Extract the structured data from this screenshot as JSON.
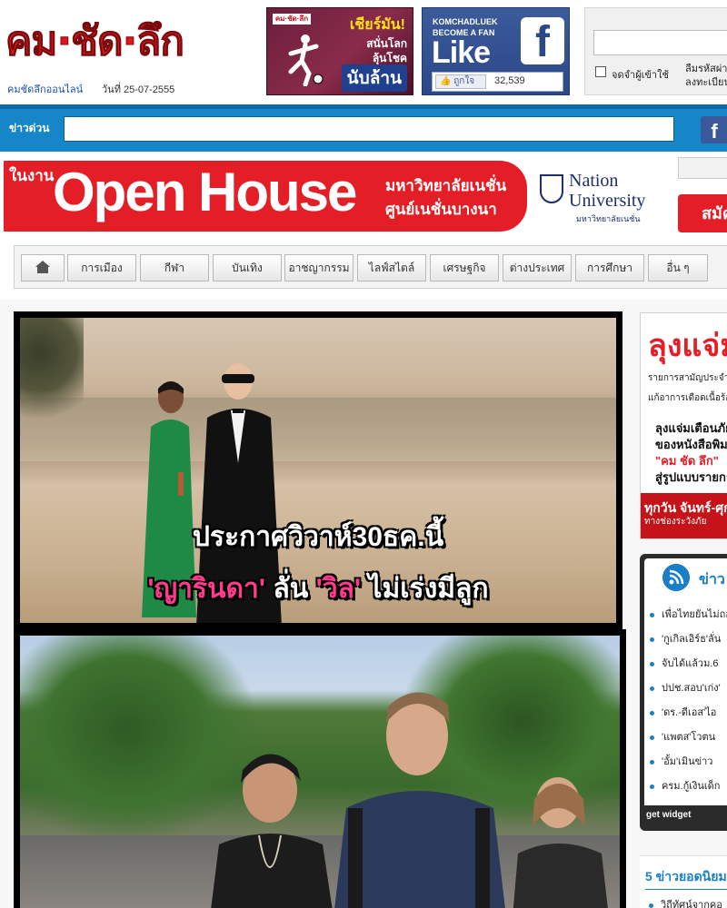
{
  "header": {
    "logo_text": "คม·ชัด·ลึก",
    "site_name": "คมชัดลึกออนไลน์",
    "date_text": "วันที่ 25-07-2555",
    "promo": {
      "logo": "คม·ชัด·ลึก",
      "line1": "เชียร์มัน!",
      "line2": "สนั่นโลก",
      "line3": "ลุ้นโชค",
      "line4": "นับล้าน"
    },
    "facebook": {
      "line1": "KOMCHADLUEK",
      "line2": "BECOME A FAN",
      "like_big": "Like",
      "f_glyph": "f",
      "like_button": "ถูกใจ",
      "like_count": "32,539"
    },
    "login": {
      "remember": "จดจำผู้เข้าใช้",
      "forgot": "ลืมรหัสผ่าน ลงทะเบียน"
    }
  },
  "news_bar": {
    "label": "ข่าวด่วน",
    "fb_glyph": "f"
  },
  "banner": {
    "small": "ในงาน",
    "big": "Open House",
    "uni_line1": "มหาวิทยาลัยเนชั่น",
    "uni_line2": "ศูนย์เนชั่นบางนา",
    "nation_line1": "Nation",
    "nation_line2": "University",
    "nation_th": "มหาวิทยาลัยเนชั่น",
    "side_button": "สมัคร"
  },
  "nav": {
    "items": [
      {
        "label": "การเมือง"
      },
      {
        "label": "กีฬา"
      },
      {
        "label": "บันเทิง"
      },
      {
        "label": "อาชญากรรม"
      },
      {
        "label": "ไลฟ์สไตล์"
      },
      {
        "label": "เศรษฐกิจ"
      },
      {
        "label": "ต่างประเทศ"
      },
      {
        "label": "การศึกษา"
      },
      {
        "label": "อื่น ๆ"
      }
    ]
  },
  "main": {
    "caption_line1": "ประกาศวิวาห์30ธค.นี้",
    "caption_name1": "'ญารินดา'",
    "caption_mid": " ลั่น ",
    "caption_name2": "'วิล'",
    "caption_end": " ไม่เร่งมีลูก"
  },
  "sidebar": {
    "ad": {
      "title": "ลุงแจ่ม",
      "sub1": "รายการสามัญประจำบ้าน",
      "sub2": "แก้อาการเดือดเนื้อร้อนใจ",
      "b1": "ลุงแจ่มเตือนภัย",
      "b2": "ของหนังสือพิมพ์",
      "b3": "\"คม ชัด ลึก\"",
      "b4": "สู่รูปแบบรายการ",
      "foot1": "ทุกวัน จันทร์-ศุกร์",
      "foot2": "ทางช่องระวังภัย"
    },
    "widget": {
      "title": "ข่าว",
      "items": [
        "เพื่อไทยยันไม่ถอน",
        "'กูเกิลเอิร์ธ'ลั่น",
        "จับได้แล้วม.6",
        "ปปช.สอบ'เก่ง'",
        "'ดร.-ดีเอส'ไอ",
        "'แพตส'โวตน",
        "'อั้ม'เมินข่าว",
        "ครม.กู้เงินเด็ก"
      ],
      "footer": "get widget"
    },
    "top5": {
      "title": "5 ข่าวยอดนิยม",
      "item": "วิถีทัศน์จากคอ"
    }
  }
}
